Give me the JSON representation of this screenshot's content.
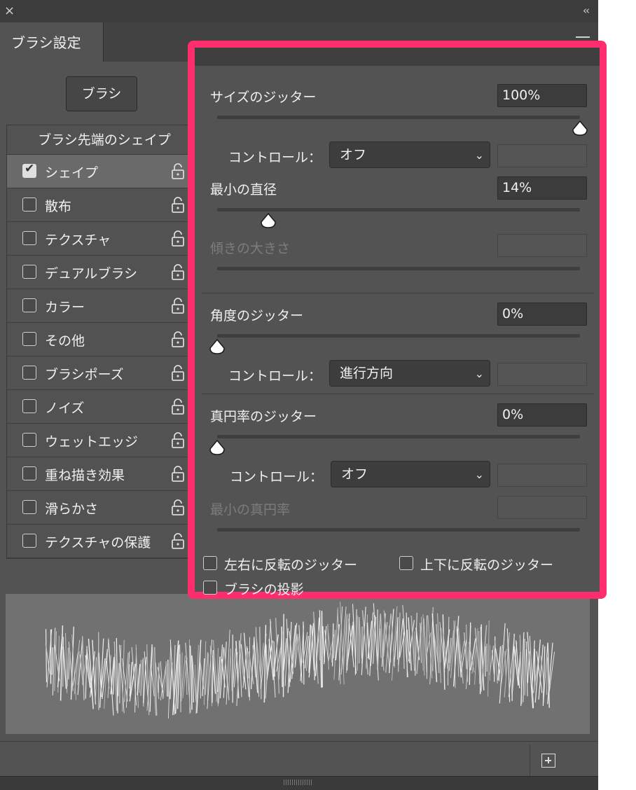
{
  "window": {
    "close_icon": "×",
    "collapse_icon": "‹‹"
  },
  "tab": {
    "title": "ブラシ設定"
  },
  "brush_button": {
    "label": "ブラシ"
  },
  "left_list": {
    "header": "ブラシ先端のシェイプ",
    "items": [
      {
        "label": "シェイプ",
        "checked": true,
        "active": true
      },
      {
        "label": "散布",
        "checked": false
      },
      {
        "label": "テクスチャ",
        "checked": false
      },
      {
        "label": "デュアルブラシ",
        "checked": false
      },
      {
        "label": "カラー",
        "checked": false
      },
      {
        "label": "その他",
        "checked": false
      },
      {
        "label": "ブラシポーズ",
        "checked": false
      },
      {
        "label": "ノイズ",
        "checked": false
      },
      {
        "label": "ウェットエッジ",
        "checked": false
      },
      {
        "label": "重ね描き効果",
        "checked": false
      },
      {
        "label": "滑らかさ",
        "checked": false
      },
      {
        "label": "テクスチャの保護",
        "checked": false
      }
    ]
  },
  "shape_settings": {
    "size_jitter": {
      "label": "サイズのジッター",
      "value": "100%",
      "slider": 1.0
    },
    "control1": {
      "label": "コントロール：",
      "value": "オフ"
    },
    "min_diameter": {
      "label": "最小の直径",
      "value": "14%",
      "slider": 0.14
    },
    "tilt_scale": {
      "label": "傾きの大きさ",
      "value": ""
    },
    "angle_jitter": {
      "label": "角度のジッター",
      "value": "0%",
      "slider": 0.0
    },
    "control2": {
      "label": "コントロール：",
      "value": "進行方向"
    },
    "roundness_jitter": {
      "label": "真円率のジッター",
      "value": "0%",
      "slider": 0.0
    },
    "control3": {
      "label": "コントロール：",
      "value": "オフ"
    },
    "min_roundness": {
      "label": "最小の真円率",
      "value": ""
    },
    "flip_x": {
      "label": "左右に反転のジッター",
      "checked": false
    },
    "flip_y": {
      "label": "上下に反転のジッター",
      "checked": false
    },
    "projection": {
      "label": "ブラシの投影",
      "checked": false
    }
  },
  "colors": {
    "highlight_border": "#ff2d6e",
    "panel_bg": "#535353"
  },
  "icons": {
    "lock": "lock-open-icon",
    "new_brush": "new-brush-icon",
    "dropdown": "chevron-down-icon"
  }
}
